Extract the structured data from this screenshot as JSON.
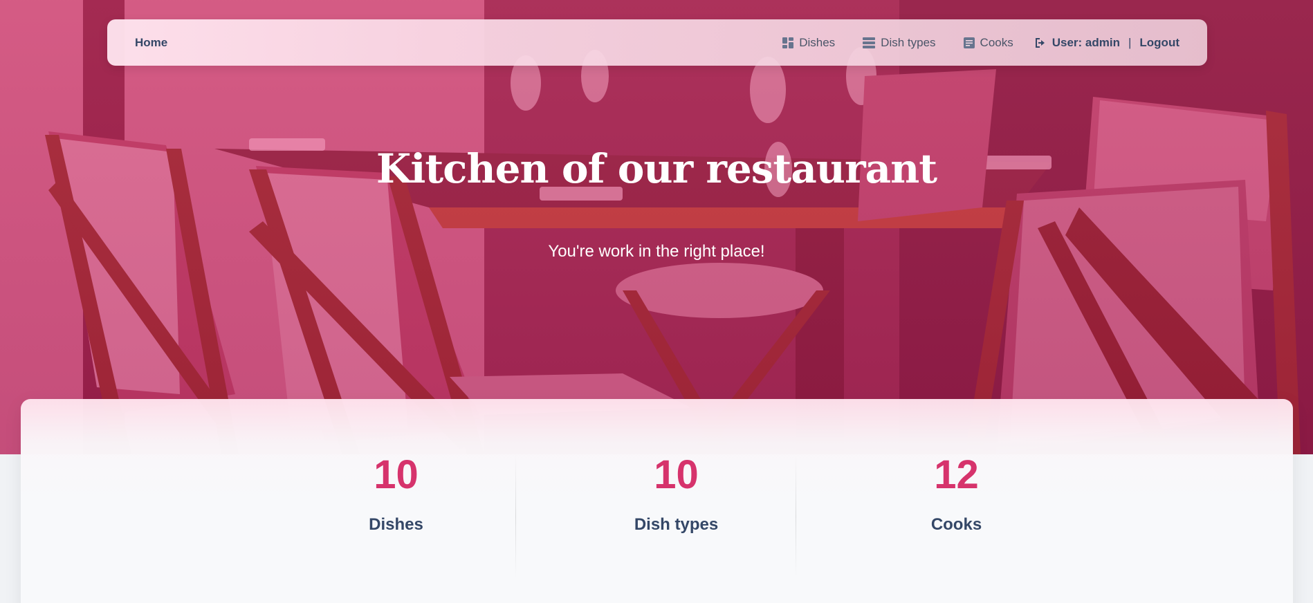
{
  "navbar": {
    "home": "Home",
    "links": [
      {
        "label": "Dishes",
        "icon": "dashboard-icon"
      },
      {
        "label": "Dish types",
        "icon": "view-stream-icon"
      },
      {
        "label": "Cooks",
        "icon": "article-icon"
      }
    ],
    "user_prefix": "User: admin",
    "separator": "|",
    "logout": "Logout"
  },
  "hero": {
    "title": "Kitchen of our restaurant",
    "subtitle": "You're work in the right place!"
  },
  "stats": [
    {
      "value": "10",
      "label": "Dishes"
    },
    {
      "value": "10",
      "label": "Dish types"
    },
    {
      "value": "12",
      "label": "Cooks"
    }
  ],
  "colors": {
    "accent": "#d6336c",
    "text": "#344767"
  }
}
